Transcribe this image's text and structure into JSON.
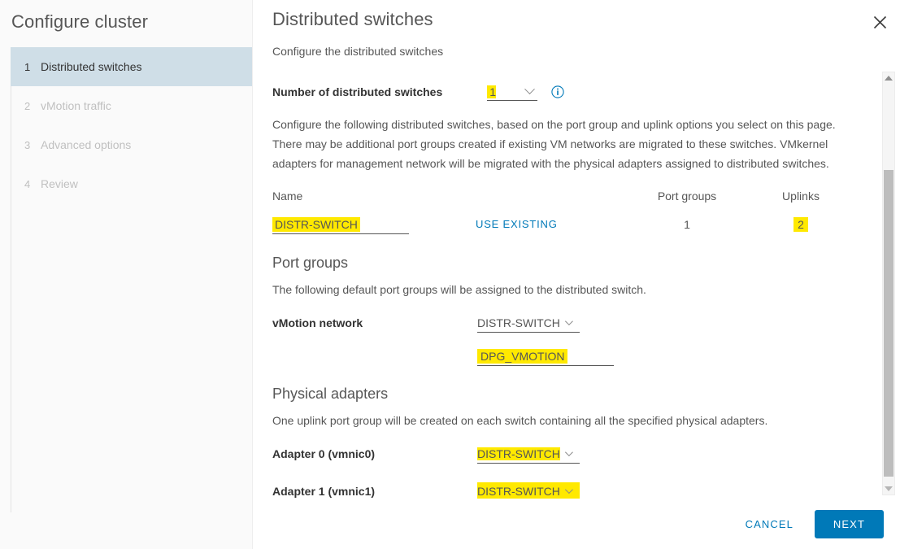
{
  "wizard": {
    "title": "Configure cluster",
    "steps": [
      {
        "num": "1",
        "label": "Distributed switches",
        "state": "active"
      },
      {
        "num": "2",
        "label": "vMotion traffic",
        "state": "disabled"
      },
      {
        "num": "3",
        "label": "Advanced options",
        "state": "disabled"
      },
      {
        "num": "4",
        "label": "Review",
        "state": "disabled"
      }
    ]
  },
  "header": {
    "title": "Distributed switches",
    "subtitle": "Configure the distributed switches",
    "close_icon": "close-icon"
  },
  "number_of_switches": {
    "label": "Number of distributed switches",
    "value": "1",
    "dropdown_icon": "chevron-down-icon",
    "info_icon": "info-circle-icon"
  },
  "description": "Configure the following distributed switches, based on the port group and uplink options you select on this page. There may be additional port groups created if existing VM networks are migrated to these switches. VMkernel adapters for management network will be migrated with the physical adapters assigned to distributed switches.",
  "switch_table": {
    "columns": [
      "Name",
      "",
      "Port groups",
      "Uplinks"
    ],
    "rows": [
      {
        "name": "DISTR-SWITCH",
        "use_existing_label": "USE EXISTING",
        "port_groups": "1",
        "uplinks": "2"
      }
    ]
  },
  "port_groups": {
    "title": "Port groups",
    "description": "The following default port groups will be assigned to the distributed switch.",
    "vmotion_label": "vMotion network",
    "vmotion_switch": "DISTR-SWITCH",
    "vmotion_portgroup": "DPG_VMOTION"
  },
  "physical_adapters": {
    "title": "Physical adapters",
    "description": "One uplink port group will be created on each switch containing all the specified physical adapters.",
    "adapters": [
      {
        "label": "Adapter 0 (vmnic0)",
        "switch": "DISTR-SWITCH"
      },
      {
        "label": "Adapter 1 (vmnic1)",
        "switch": "DISTR-SWITCH"
      }
    ]
  },
  "footer": {
    "cancel_label": "CANCEL",
    "next_label": "NEXT"
  },
  "scrollbar": {
    "up_icon": "triangle-up-icon",
    "down_icon": "triangle-down-icon"
  },
  "colors": {
    "accent": "#0079b8",
    "highlight": "#ffe900",
    "active_step_bg": "#cfdee7",
    "text": "#565656"
  }
}
